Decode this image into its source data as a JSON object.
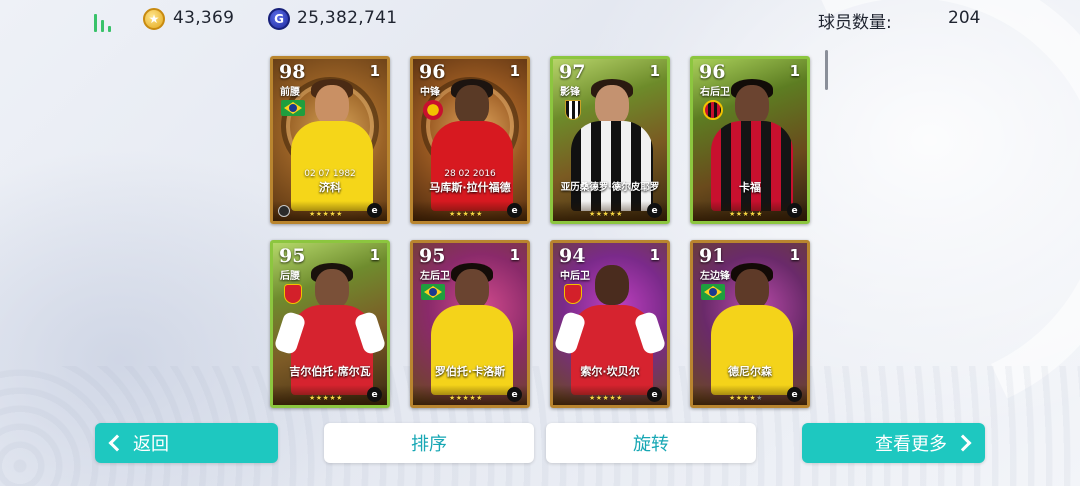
{
  "header": {
    "coins": "43,369",
    "gp": "25,382,741",
    "player_count_label": "球员数量:",
    "player_count_value": "204"
  },
  "cards": [
    {
      "ovr": "98",
      "level": "1",
      "position": "前腰",
      "badge": "flag-brazil",
      "date": "02 07 1982",
      "name": "济科",
      "stars": 5
    },
    {
      "ovr": "96",
      "level": "1",
      "position": "中锋",
      "badge": "crest-manchester-united",
      "date": "28 02 2016",
      "name": "马库斯·拉什福德",
      "stars": 5
    },
    {
      "ovr": "97",
      "level": "1",
      "position": "影锋",
      "badge": "crest-juventus",
      "date": "",
      "name": "亚历桑德罗·德尔皮耶罗",
      "stars": 5
    },
    {
      "ovr": "96",
      "level": "1",
      "position": "右后卫",
      "badge": "crest-ac-milan",
      "date": "",
      "name": "卡福",
      "stars": 5
    },
    {
      "ovr": "95",
      "level": "1",
      "position": "后腰",
      "badge": "crest-arsenal",
      "date": "",
      "name": "吉尔伯托·席尔瓦",
      "stars": 5
    },
    {
      "ovr": "95",
      "level": "1",
      "position": "左后卫",
      "badge": "flag-brazil",
      "date": "",
      "name": "罗伯托·卡洛斯",
      "stars": 5
    },
    {
      "ovr": "94",
      "level": "1",
      "position": "中后卫",
      "badge": "crest-arsenal",
      "date": "",
      "name": "索尔·坎贝尔",
      "stars": 5
    },
    {
      "ovr": "91",
      "level": "1",
      "position": "左边锋",
      "badge": "flag-brazil",
      "date": "",
      "name": "德尼尔森",
      "stars": 4
    }
  ],
  "buttons": {
    "back": "返回",
    "sort": "排序",
    "rotate": "旋转",
    "more": "查看更多"
  },
  "colors": {
    "accent_teal": "#1ec8c0",
    "text_teal": "#17a7b4",
    "card_gold_border": "#b9852f",
    "card_green_border": "#8cc63f"
  }
}
